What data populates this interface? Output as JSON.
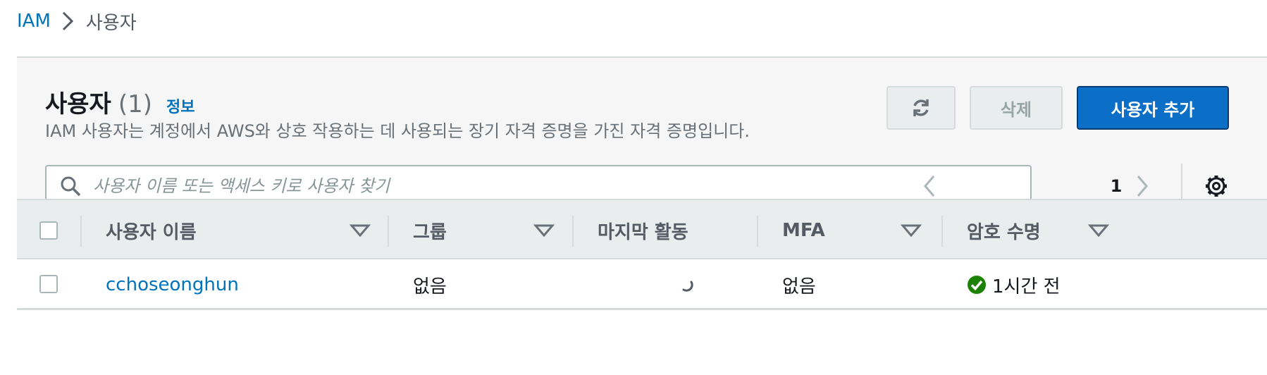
{
  "breadcrumb": {
    "root": "IAM",
    "current": "사용자"
  },
  "panel": {
    "title": "사용자",
    "count": "(1)",
    "info_link": "정보",
    "description": "IAM 사용자는 계정에서 AWS와 상호 작용하는 데 사용되는 장기 자격 증명을 가진 자격 증명입니다."
  },
  "actions": {
    "refresh_icon": "refresh-icon",
    "delete_label": "삭제",
    "add_user_label": "사용자 추가"
  },
  "search": {
    "placeholder": "사용자 이름 또는 액세스 키로 사용자 찾기",
    "value": ""
  },
  "pagination": {
    "current_page": "1"
  },
  "table": {
    "columns": [
      "사용자 이름",
      "그룹",
      "마지막 활동",
      "MFA",
      "암호 수명"
    ],
    "rows": [
      {
        "user_name": "cchoseonghun",
        "groups": "없음",
        "last_activity": "",
        "mfa": "없음",
        "password_age": "1시간 전"
      }
    ]
  },
  "colors": {
    "link": "#0073bb",
    "primary_button": "#0b6fc7",
    "success": "#1d8102",
    "panel_bg": "#f6f6f6",
    "header_bg": "#eaeded"
  }
}
